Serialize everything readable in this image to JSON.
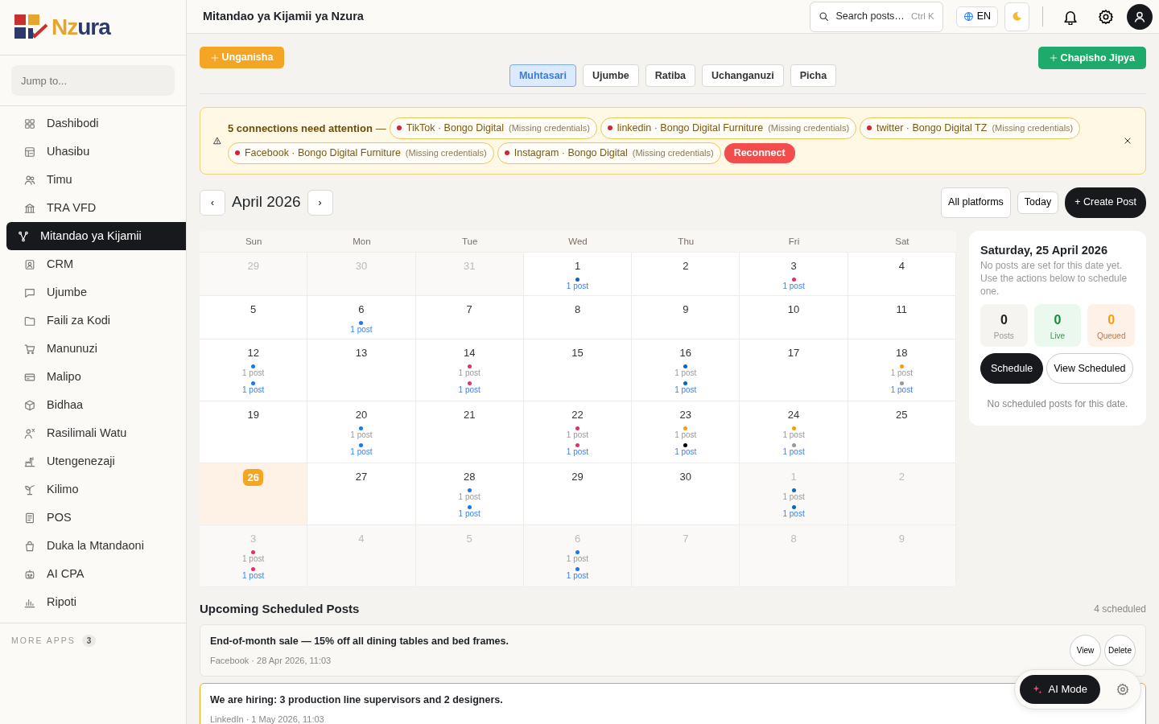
{
  "sidebar": {
    "logo": [
      "Nz",
      "ura"
    ],
    "search": {
      "placeholder": "Jump to..."
    },
    "items": [
      {
        "label": "Dashibodi",
        "selected": false
      },
      {
        "label": "Uhasibu",
        "selected": false
      },
      {
        "label": "Timu",
        "selected": false
      },
      {
        "label": "TRA VFD",
        "selected": false
      },
      {
        "label": "Mitandao ya Kijamii",
        "selected": true
      },
      {
        "label": "CRM",
        "selected": false
      },
      {
        "label": "Ujumbe",
        "selected": false
      },
      {
        "label": "Faili za Kodi",
        "selected": false
      },
      {
        "label": "Manunuzi",
        "selected": false
      },
      {
        "label": "Malipo",
        "selected": false
      },
      {
        "label": "Bidhaa",
        "selected": false
      },
      {
        "label": "Rasilimali Watu",
        "selected": false
      },
      {
        "label": "Utengenezaji",
        "selected": false
      },
      {
        "label": "Kilimo",
        "selected": false
      },
      {
        "label": "POS",
        "selected": false
      },
      {
        "label": "Duka la Mtandaoni",
        "selected": false
      },
      {
        "label": "AI CPA",
        "selected": false
      },
      {
        "label": "Ripoti",
        "selected": false
      }
    ],
    "more_apps": {
      "label": "MORE APPS",
      "count": "3"
    }
  },
  "header": {
    "title": "Mitandao ya Kijamii ya Nzura",
    "search": {
      "placeholder": "Search posts…",
      "shortcut": "Ctrl K"
    },
    "language": "EN"
  },
  "toolbar": {
    "connect_button": "Unganisha",
    "new_post_button": "Chapisho Jipya"
  },
  "tabs": [
    {
      "label": "Muhtasari",
      "selected": true
    },
    {
      "label": "Ujumbe",
      "selected": false
    },
    {
      "label": "Ratiba",
      "selected": false
    },
    {
      "label": "Uchanganuzi",
      "selected": false
    },
    {
      "label": "Picha",
      "selected": false
    }
  ],
  "alert": {
    "title": "5 connections need attention",
    "separator": "—",
    "button": "Reconnect",
    "connections": [
      {
        "label": "TikTok · Bongo Digital",
        "note": "(Missing credentials)"
      },
      {
        "label": "linkedin · Bongo Digital Furniture",
        "note": "(Missing credentials)"
      },
      {
        "label": "twitter · Bongo Digital TZ",
        "note": "(Missing credentials)"
      },
      {
        "label": "Facebook · Bongo Digital Furniture",
        "note": "(Missing credentials)"
      },
      {
        "label": "Instagram · Bongo Digital",
        "note": "(Missing credentials)"
      }
    ]
  },
  "calendar": {
    "prev": "‹",
    "next": "›",
    "month": "April 2026",
    "filter": "All platforms",
    "today_button": "Today",
    "create_button": "+ Create Post",
    "weekdays": [
      "Sun",
      "Mon",
      "Tue",
      "Wed",
      "Thu",
      "Fri",
      "Sat"
    ],
    "weeks": [
      [
        {
          "day": "29",
          "outside": true,
          "today": false
        },
        {
          "day": "30",
          "outside": true,
          "today": false
        },
        {
          "day": "31",
          "outside": true,
          "today": false
        },
        {
          "day": "1",
          "outside": false,
          "today": false,
          "entries": [
            {
              "kind": "scheduled",
              "color": "#0a66c2",
              "label": "1 post"
            }
          ]
        },
        {
          "day": "2",
          "outside": false,
          "today": false
        },
        {
          "day": "3",
          "outside": false,
          "today": false,
          "entries": [
            {
              "kind": "scheduled",
              "color": "#e1306c",
              "label": "1 post"
            }
          ]
        },
        {
          "day": "4",
          "outside": false,
          "today": false
        }
      ],
      [
        {
          "day": "5",
          "outside": false,
          "today": false
        },
        {
          "day": "6",
          "outside": false,
          "today": false,
          "entries": [
            {
              "kind": "scheduled",
              "color": "#1877f2",
              "label": "1 post"
            }
          ]
        },
        {
          "day": "7",
          "outside": false,
          "today": false
        },
        {
          "day": "8",
          "outside": false,
          "today": false
        },
        {
          "day": "9",
          "outside": false,
          "today": false
        },
        {
          "day": "10",
          "outside": false,
          "today": false
        },
        {
          "day": "11",
          "outside": false,
          "today": false
        }
      ],
      [
        {
          "day": "12",
          "outside": false,
          "today": false,
          "entries": [
            {
              "kind": "published",
              "color": "#1877f2",
              "label": "1 post"
            },
            {
              "kind": "scheduled",
              "color": "#1877f2",
              "label": "1 post"
            }
          ]
        },
        {
          "day": "13",
          "outside": false,
          "today": false
        },
        {
          "day": "14",
          "outside": false,
          "today": false,
          "entries": [
            {
              "kind": "published",
              "color": "#e1306c",
              "label": "1 post"
            },
            {
              "kind": "scheduled",
              "color": "#e1306c",
              "label": "1 post"
            }
          ]
        },
        {
          "day": "15",
          "outside": false,
          "today": false
        },
        {
          "day": "16",
          "outside": false,
          "today": false,
          "entries": [
            {
              "kind": "published",
              "color": "#0a66c2",
              "label": "1 post"
            },
            {
              "kind": "scheduled",
              "color": "#0a66c2",
              "label": "1 post"
            }
          ]
        },
        {
          "day": "17",
          "outside": false,
          "today": false
        },
        {
          "day": "18",
          "outside": false,
          "today": false,
          "entries": [
            {
              "kind": "published",
              "color": "#f59e0b",
              "label": "1 post"
            },
            {
              "kind": "scheduled",
              "color": "#999999",
              "label": "1 post"
            }
          ]
        }
      ],
      [
        {
          "day": "19",
          "outside": false,
          "today": false
        },
        {
          "day": "20",
          "outside": false,
          "today": false,
          "entries": [
            {
              "kind": "published",
              "color": "#1877f2",
              "label": "1 post"
            },
            {
              "kind": "scheduled",
              "color": "#1877f2",
              "label": "1 post"
            }
          ]
        },
        {
          "day": "21",
          "outside": false,
          "today": false
        },
        {
          "day": "22",
          "outside": false,
          "today": false,
          "entries": [
            {
              "kind": "published",
              "color": "#e1306c",
              "label": "1 post"
            },
            {
              "kind": "scheduled",
              "color": "#e1306c",
              "label": "1 post"
            }
          ]
        },
        {
          "day": "23",
          "outside": false,
          "today": false,
          "entries": [
            {
              "kind": "published",
              "color": "#f59e0b",
              "label": "1 post"
            },
            {
              "kind": "scheduled",
              "color": "#000000",
              "label": "1 post"
            }
          ]
        },
        {
          "day": "24",
          "outside": false,
          "today": false,
          "entries": [
            {
              "kind": "published",
              "color": "#f59e0b",
              "label": "1 post"
            },
            {
              "kind": "scheduled",
              "color": "#999999",
              "label": "1 post"
            }
          ]
        },
        {
          "day": "25",
          "outside": false,
          "today": false
        }
      ],
      [
        {
          "day": "26",
          "outside": false,
          "today": true
        },
        {
          "day": "27",
          "outside": false,
          "today": false
        },
        {
          "day": "28",
          "outside": false,
          "today": false,
          "entries": [
            {
              "kind": "published",
              "color": "#1877f2",
              "label": "1 post"
            },
            {
              "kind": "scheduled",
              "color": "#1877f2",
              "label": "1 post"
            }
          ]
        },
        {
          "day": "29",
          "outside": false,
          "today": false
        },
        {
          "day": "30",
          "outside": false,
          "today": false
        },
        {
          "day": "1",
          "outside": true,
          "today": false,
          "entries": [
            {
              "kind": "published",
              "color": "#0a66c2",
              "label": "1 post"
            },
            {
              "kind": "scheduled",
              "color": "#0a66c2",
              "label": "1 post"
            }
          ]
        },
        {
          "day": "2",
          "outside": true,
          "today": false
        }
      ],
      [
        {
          "day": "3",
          "outside": true,
          "today": false,
          "entries": [
            {
              "kind": "published",
              "color": "#e1306c",
              "label": "1 post"
            },
            {
              "kind": "scheduled",
              "color": "#e1306c",
              "label": "1 post"
            }
          ]
        },
        {
          "day": "4",
          "outside": true,
          "today": false
        },
        {
          "day": "5",
          "outside": true,
          "today": false
        },
        {
          "day": "6",
          "outside": true,
          "today": false,
          "entries": [
            {
              "kind": "published",
              "color": "#1877f2",
              "label": "1 post"
            },
            {
              "kind": "scheduled",
              "color": "#1877f2",
              "label": "1 post"
            }
          ]
        },
        {
          "day": "7",
          "outside": true,
          "today": false
        },
        {
          "day": "8",
          "outside": true,
          "today": false
        },
        {
          "day": "9",
          "outside": true,
          "today": false
        }
      ]
    ]
  },
  "day_panel": {
    "title": "Saturday, 25 April 2026",
    "text": "No posts are set for this date yet. Use the actions below to schedule one.",
    "stats": [
      {
        "kind": "total",
        "value": "0",
        "label": "Posts"
      },
      {
        "kind": "live",
        "value": "0",
        "label": "Live"
      },
      {
        "kind": "queued",
        "value": "0",
        "label": "Queued"
      }
    ],
    "schedule_button": "Schedule",
    "view_button": "View Scheduled",
    "empty": "No scheduled posts for this date."
  },
  "upcoming": {
    "title": "Upcoming Scheduled Posts",
    "count": "4 scheduled",
    "posts": [
      {
        "text": "End-of-month sale — 15% off all dining tables and bed frames.",
        "meta": "Facebook · 28 Apr 2026, 11:03",
        "highlighted": false,
        "actions": [
          "View",
          "Delete"
        ]
      },
      {
        "text": "We are hiring: 3 production line supervisors and 2 designers.",
        "meta": "LinkedIn · 1 May 2026, 11:03",
        "highlighted": true
      }
    ]
  },
  "ai_widget": {
    "button": "AI Mode"
  }
}
